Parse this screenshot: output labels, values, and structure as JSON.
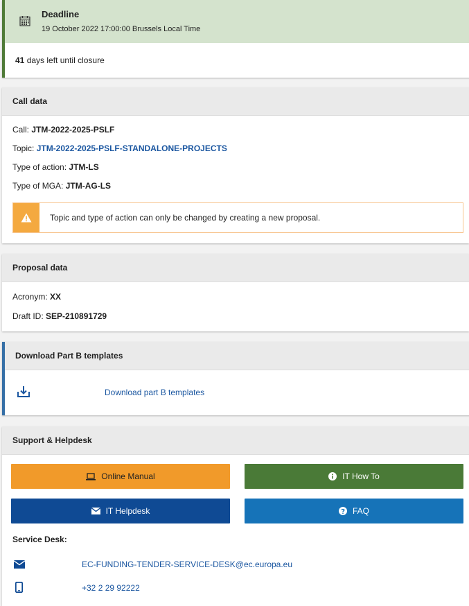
{
  "deadline": {
    "title": "Deadline",
    "date": "19 October 2022 17:00:00 Brussels Local Time",
    "days_left": "41",
    "days_left_suffix": " days left until closure"
  },
  "call_data": {
    "header": "Call data",
    "call_label": "Call: ",
    "call_value": "JTM-2022-2025-PSLF",
    "topic_label": "Topic: ",
    "topic_value": "JTM-2022-2025-PSLF-STANDALONE-PROJECTS",
    "action_label": "Type of action: ",
    "action_value": "JTM-LS",
    "mga_label": "Type of MGA: ",
    "mga_value": "JTM-AG-LS",
    "warning": "Topic and type of action can only be changed by creating a new proposal."
  },
  "proposal_data": {
    "header": "Proposal data",
    "acronym_label": "Acronym: ",
    "acronym_value": "XX",
    "draft_label": "Draft ID: ",
    "draft_value": "SEP-210891729"
  },
  "download": {
    "header": "Download Part B templates",
    "link": "Download part B templates"
  },
  "support": {
    "header": "Support & Helpdesk",
    "buttons": {
      "manual": "Online Manual",
      "howto": "IT How To",
      "helpdesk": "IT Helpdesk",
      "faq": "FAQ"
    },
    "service_desk_label": "Service Desk:",
    "email": "EC-FUNDING-TENDER-SERVICE-DESK@ec.europa.eu",
    "phone": "+32 2 29 92222"
  },
  "colors": {
    "deadline_bg": "#d4e3cd",
    "deadline_accent": "#4f7a37",
    "warning": "#f4a940",
    "manual_btn": "#f19a2a",
    "howto_btn": "#4a7a37",
    "helpdesk_btn": "#0f4a94",
    "faq_btn": "#1673b8",
    "link": "#1a56a0"
  },
  "icons": [
    "calendar-icon",
    "warning-icon",
    "download-icon",
    "laptop-icon",
    "info-icon",
    "envelope-icon",
    "question-icon",
    "mobile-icon"
  ]
}
